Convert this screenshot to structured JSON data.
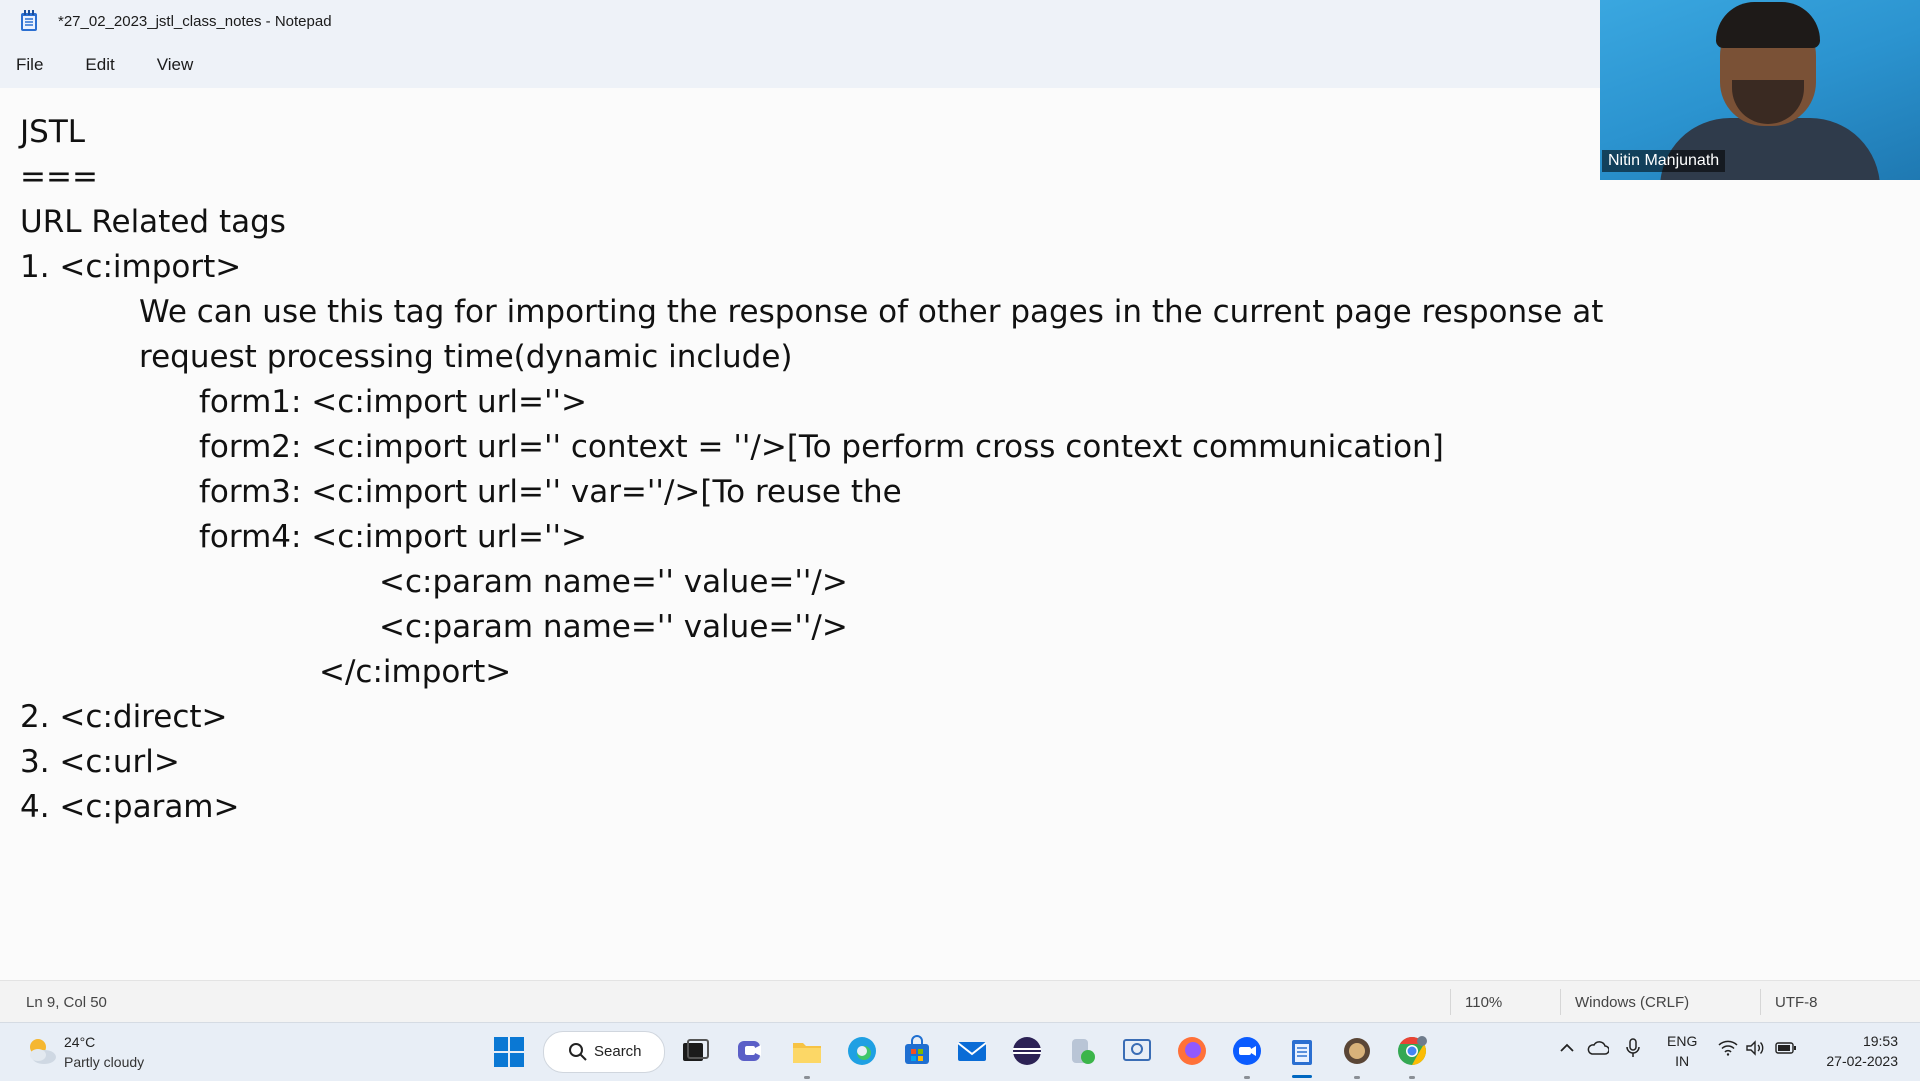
{
  "window": {
    "title": "*27_02_2023_jstl_class_notes - Notepad"
  },
  "menu": {
    "items": [
      "File",
      "Edit",
      "View"
    ]
  },
  "editor": {
    "lines": [
      "JSTL",
      "===",
      "URL Related tags",
      "1. <c:import>",
      "We can use this tag for importing the response of other pages in the current page response at",
      "request processing time(dynamic include)",
      "form1: <c:import url=''>",
      "form2: <c:import url='' context = ''/>[To perform cross context communication]",
      "form3: <c:import url='' var=''/>[To reuse the",
      "form4: <c:import url=''>",
      "<c:param name='' value=''/>",
      "<c:param name='' value=''/>",
      "</c:import>",
      "2. <c:direct>",
      "3. <c:url>",
      "4. <c:param>"
    ]
  },
  "video": {
    "participant_name": "Nitin Manjunath"
  },
  "status": {
    "position": "Ln 9, Col 50",
    "zoom": "110%",
    "line_ending": "Windows (CRLF)",
    "encoding": "UTF-8"
  },
  "taskbar": {
    "weather_temp": "24°C",
    "weather_condition": "Partly cloudy",
    "search_label": "Search",
    "lang_top": "ENG",
    "lang_bottom": "IN",
    "time": "19:53",
    "date": "27-02-2023",
    "accent_color": "#0067c0"
  }
}
